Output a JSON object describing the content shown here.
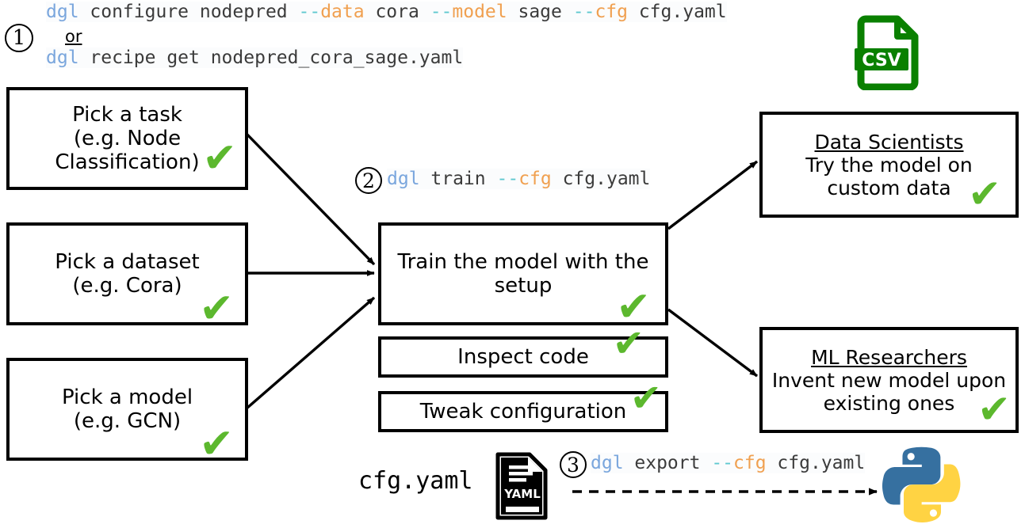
{
  "steps": {
    "one": "1",
    "two": "2",
    "three": "3"
  },
  "commands": {
    "configure": {
      "cmd": "dgl",
      "sub": " configure nodepred ",
      "dash1": "--",
      "flag1": "data",
      "val1": " cora ",
      "dash2": "--",
      "flag2": "model",
      "val2": " sage ",
      "dash3": "--",
      "flag3": "cfg",
      "val3": " cfg.yaml"
    },
    "or_label": "or",
    "recipe": {
      "cmd": "dgl",
      "rest": " recipe get nodepred_cora_sage.yaml"
    },
    "train": {
      "cmd": "dgl",
      "sub": " train ",
      "dash": "--",
      "flag": "cfg",
      "val": " cfg.yaml"
    },
    "export": {
      "cmd": "dgl",
      "sub": " export ",
      "dash": "--",
      "flag": "cfg",
      "val": " cfg.yaml"
    }
  },
  "inputs": [
    {
      "line1": "Pick a task",
      "line2": "(e.g. Node",
      "line3": "Classification)",
      "check": "✔"
    },
    {
      "line1": "Pick a dataset",
      "line2": "(e.g. Cora)",
      "line3": "",
      "check": "✔"
    },
    {
      "line1": "Pick a model",
      "line2": "(e.g. GCN)",
      "line3": "",
      "check": "✔"
    }
  ],
  "middle": {
    "train_box": {
      "text": "Train the model with the setup",
      "check": "✔"
    },
    "inspect_box": {
      "text": "Inspect code",
      "check": "✔"
    },
    "tweak_box": {
      "text": "Tweak configuration",
      "check": "✔"
    }
  },
  "outputs": [
    {
      "title": "Data Scientists",
      "line1": "Try the model on",
      "line2": "custom data",
      "check": "✔"
    },
    {
      "title": "ML Researchers",
      "line1": "Invent new model upon",
      "line2": "existing ones",
      "check": "✔"
    }
  ],
  "files": {
    "cfg_label": "cfg.yaml",
    "yaml_icon_label": "YAML",
    "csv_icon_label": "CSV"
  },
  "colors": {
    "check_green": "#5cb82e",
    "csv_green": "#0a8000",
    "python_blue": "#3670a0",
    "python_yellow": "#ffd343",
    "code_cmd_blue": "#7aa6dd",
    "code_dash_teal": "#5ec8cf",
    "code_flag_orange": "#f0a050",
    "stroke_black": "#000000"
  },
  "icons": {
    "csv": "csv-file-icon",
    "yaml": "yaml-file-icon",
    "python": "python-logo-icon"
  }
}
